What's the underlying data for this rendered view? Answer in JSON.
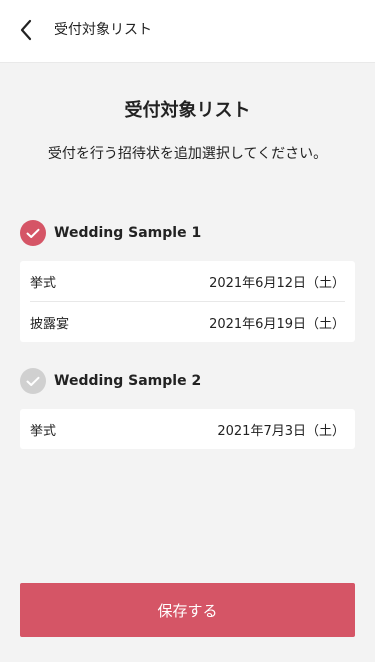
{
  "header": {
    "title": "受付対象リスト"
  },
  "main": {
    "title": "受付対象リスト",
    "description": "受付を行う招待状を追加選択してください。"
  },
  "events": [
    {
      "name": "Wedding Sample 1",
      "selected": true,
      "rows": [
        {
          "label": "挙式",
          "date": "2021年6月12日（土）"
        },
        {
          "label": "披露宴",
          "date": "2021年6月19日（土）"
        }
      ]
    },
    {
      "name": "Wedding Sample 2",
      "selected": false,
      "rows": [
        {
          "label": "挙式",
          "date": "2021年7月3日（土）"
        }
      ]
    }
  ],
  "footer": {
    "save_label": "保存する"
  },
  "colors": {
    "accent": "#d55566",
    "unchecked": "#d0d0d0",
    "background": "#f3f3f3"
  },
  "icons": {
    "back": "chevron-left-icon",
    "check": "check-icon"
  }
}
